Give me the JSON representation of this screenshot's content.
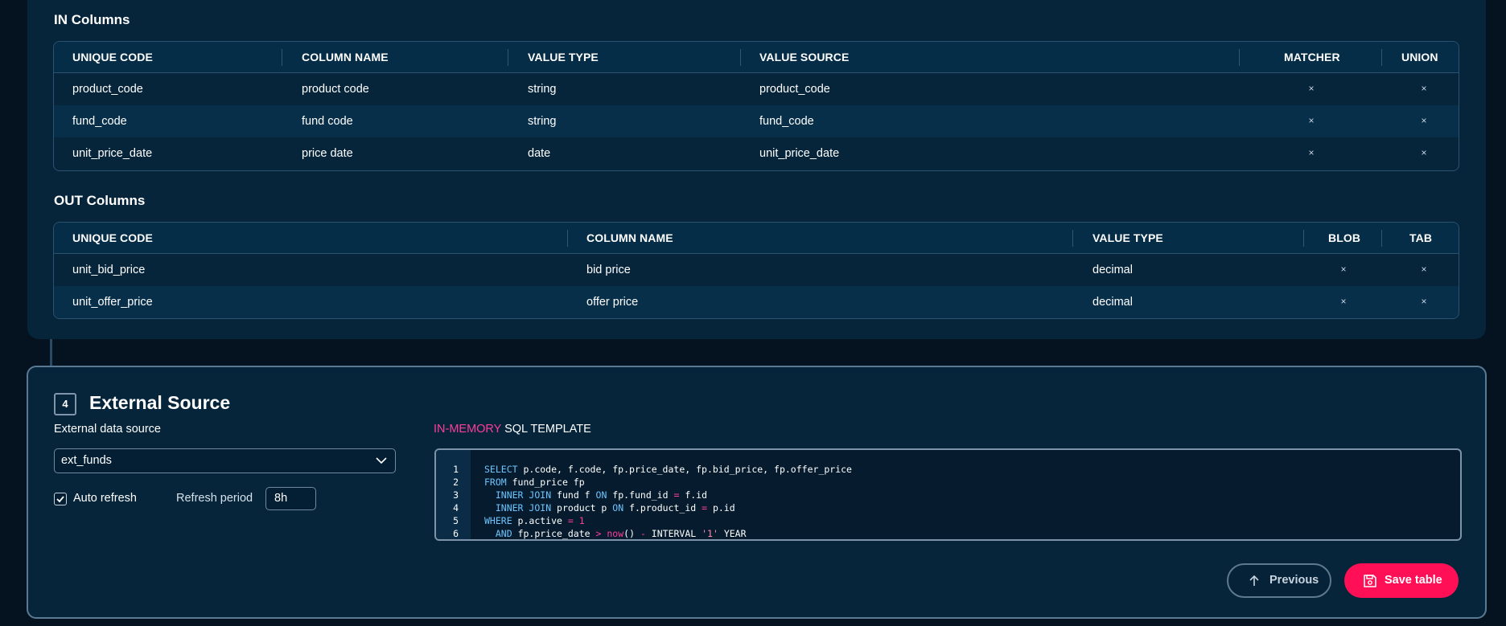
{
  "in_columns": {
    "title": "IN Columns",
    "headers": [
      "UNIQUE CODE",
      "COLUMN NAME",
      "VALUE TYPE",
      "VALUE SOURCE",
      "MATCHER",
      "UNION"
    ],
    "rows": [
      [
        "product_code",
        "product code",
        "string",
        "product_code",
        "×",
        "×"
      ],
      [
        "fund_code",
        "fund code",
        "string",
        "fund_code",
        "×",
        "×"
      ],
      [
        "unit_price_date",
        "price date",
        "date",
        "unit_price_date",
        "×",
        "×"
      ]
    ]
  },
  "out_columns": {
    "title": "OUT Columns",
    "headers": [
      "UNIQUE CODE",
      "COLUMN NAME",
      "VALUE TYPE",
      "BLOB",
      "TAB"
    ],
    "rows": [
      [
        "unit_bid_price",
        "bid price",
        "decimal",
        "×",
        "×"
      ],
      [
        "unit_offer_price",
        "offer price",
        "decimal",
        "×",
        "×"
      ]
    ]
  },
  "external_source": {
    "step_number": "4",
    "title": "External Source",
    "data_source_label": "External data source",
    "data_source_value": "ext_funds",
    "auto_refresh_label": "Auto refresh",
    "auto_refresh_checked": true,
    "refresh_period_label": "Refresh period",
    "refresh_period_value": "8h",
    "sql_title_highlight": "IN-MEMORY",
    "sql_title_rest": " SQL TEMPLATE",
    "sql_line_numbers": [
      "1",
      "2",
      "3",
      "4",
      "5",
      "6"
    ],
    "sql_lines": [
      "SELECT p.code, f.code, fp.price_date, fp.bid_price, fp.offer_price",
      "FROM fund_price fp",
      "  INNER JOIN fund f ON fp.fund_id = f.id",
      "  INNER JOIN product p ON f.product_id = p.id",
      "WHERE p.active = 1",
      "  AND fp.price_date > now() - INTERVAL '1' YEAR"
    ]
  },
  "actions": {
    "previous_label": "Previous",
    "save_label": "Save table"
  },
  "colors": {
    "background": "#04131f",
    "card": "#06253b",
    "accent": "#ff0f56",
    "keyword": "#6cc4ff",
    "highlight": "#ff3d9a"
  }
}
